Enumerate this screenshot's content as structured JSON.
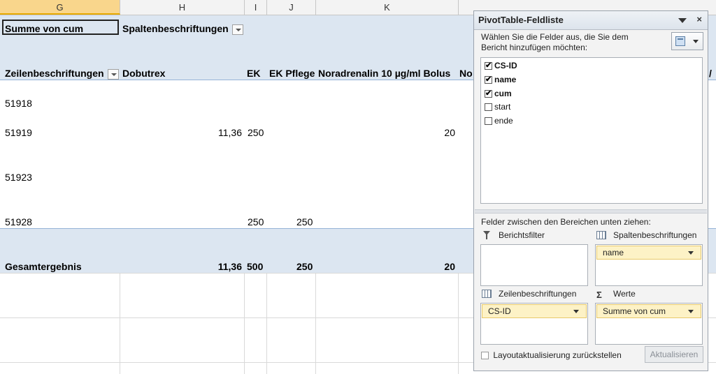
{
  "columns": [
    "G",
    "H",
    "I",
    "J",
    "K"
  ],
  "pivot": {
    "corner_label": "Summe von cum",
    "col_labels_header": "Spaltenbeschriftungen",
    "row_labels_header": "Zeilenbeschriftungen",
    "col_headers": [
      "Dobutrex",
      "EK",
      "EK Pflege",
      "Noradrenalin 10 µg/ml Bolus",
      "No"
    ],
    "rows": [
      {
        "id": "51918",
        "dobutrex": "",
        "ek": "",
        "ek_pflege": "",
        "nora": ""
      },
      {
        "id": "51919",
        "dobutrex": "11,36",
        "ek": "250",
        "ek_pflege": "",
        "nora": "20"
      },
      {
        "id": "51923",
        "dobutrex": "",
        "ek": "",
        "ek_pflege": "",
        "nora": ""
      },
      {
        "id": "51928",
        "dobutrex": "",
        "ek": "250",
        "ek_pflege": "250",
        "nora": ""
      }
    ],
    "total": {
      "label": "Gesamtergebnis",
      "dobutrex": "11,36",
      "ek": "500",
      "ek_pflege": "250",
      "nora": "20"
    },
    "right_edge_fragment": "/"
  },
  "field_list": {
    "title": "PivotTable-Feldliste",
    "close": "×",
    "instruction": "Wählen Sie die Felder aus, die Sie dem Bericht hinzufügen möchten:",
    "fields": [
      {
        "label": "CS-ID",
        "checked": true
      },
      {
        "label": "name",
        "checked": true
      },
      {
        "label": "cum",
        "checked": true
      },
      {
        "label": "start",
        "checked": false
      },
      {
        "label": "ende",
        "checked": false
      }
    ],
    "drag_text": "Felder zwischen den Bereichen unten ziehen:",
    "areas": {
      "report_filter": {
        "label": "Berichtsfilter",
        "value": ""
      },
      "column_labels": {
        "label": "Spaltenbeschriftungen",
        "value": "name"
      },
      "row_labels": {
        "label": "Zeilenbeschriftungen",
        "value": "CS-ID"
      },
      "values": {
        "label": "Werte",
        "value": "Summe von cum"
      }
    },
    "defer_label": "Layoutaktualisierung zurückstellen",
    "update_label": "Aktualisieren"
  }
}
